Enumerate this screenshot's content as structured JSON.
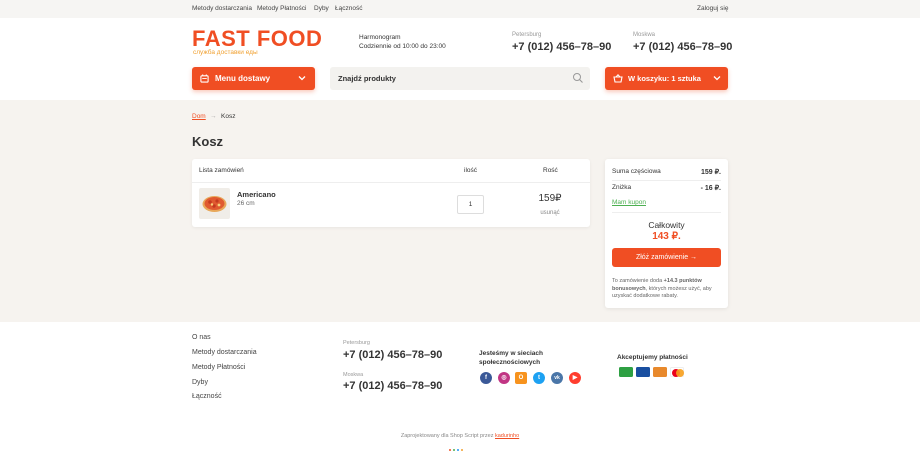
{
  "topbar": {
    "links": [
      "Metody dostarczania",
      "Metody Płatności",
      "Dyby",
      "Łączność"
    ],
    "login": "Zaloguj się"
  },
  "header": {
    "logo": "FAST FOOD",
    "logo_sub": "служба доставки еды",
    "schedule_title": "Harmonogram",
    "schedule_value": "Codziennie od 10:00 do 23:00",
    "contacts": [
      {
        "city": "Petersburg",
        "phone": "+7 (012) 456–78–90"
      },
      {
        "city": "Moskwa",
        "phone": "+7 (012) 456–78–90"
      }
    ]
  },
  "nav": {
    "menu_label": "Menu dostawy",
    "search_placeholder": "Znajdź produkty",
    "cart_label": "W koszyku: 1 sztuka"
  },
  "breadcrumb": {
    "home": "Dom",
    "arrow": "→",
    "current": "Kosz"
  },
  "page_title": "Kosz",
  "cart": {
    "headers": {
      "list": "Lista zamówień",
      "qty": "ilość",
      "price": "Rość"
    },
    "items": [
      {
        "name": "Americano",
        "size": "26 cm",
        "qty": "1",
        "price": "159₽",
        "remove": "usunąć"
      }
    ]
  },
  "summary": {
    "subtotal_label": "Suma częściowa",
    "subtotal_value": "159 ₽.",
    "discount_label": "Zniżka",
    "discount_value": "- 16 ₽.",
    "coupon": "Mam kupon",
    "total_label": "Całkowity",
    "total_value": "143 ₽.",
    "order_button": "Złóż zamówienie →",
    "bonus_pre": "To zamówienie doda ",
    "bonus_points": "+14.3 punktów bonusowych",
    "bonus_post": ", których możesz użyć, aby uzyskać dodatkowe rabaty."
  },
  "footer": {
    "links": [
      "O nas",
      "Metody dostarczania",
      "Metody Płatności",
      "Dyby",
      "Łączność"
    ],
    "contacts": [
      {
        "city": "Petersburg",
        "phone": "+7 (012) 456–78–90"
      },
      {
        "city": "Moskwa",
        "phone": "+7 (012) 456–78–90"
      }
    ],
    "social_title": "Jesteśmy w sieciach społecznościowych",
    "social_icons": [
      {
        "icon": "facebook-icon",
        "glyph": "f",
        "color": "#3b5998"
      },
      {
        "icon": "instagram-icon",
        "glyph": "◎",
        "color": "#c13584"
      },
      {
        "icon": "odnoklassniki-icon",
        "glyph": "O",
        "color": "#f7931e"
      },
      {
        "icon": "twitter-icon",
        "glyph": "t",
        "color": "#1da1f2"
      },
      {
        "icon": "vk-icon",
        "glyph": "vk",
        "color": "#4a76a8"
      },
      {
        "icon": "youtube-icon",
        "glyph": "▶",
        "color": "#ff3d2e"
      }
    ],
    "payment_title": "Akceptujemy płatności",
    "payments": [
      {
        "icon": "mir-card-icon",
        "color": "#2ea043"
      },
      {
        "icon": "visa-card-icon",
        "color": "#1a4fa0"
      },
      {
        "icon": "card-icon",
        "color": "#e8892c"
      },
      {
        "icon": "mastercard-icon",
        "color": "#ffffff"
      }
    ],
    "credit_pre": "Zaprojektowany dla Shop Script przez ",
    "credit_link": "kadurinho"
  },
  "colors": {
    "accent": "#f04e23",
    "coupon": "#4caf50",
    "bg_light": "#f6f3ef"
  }
}
